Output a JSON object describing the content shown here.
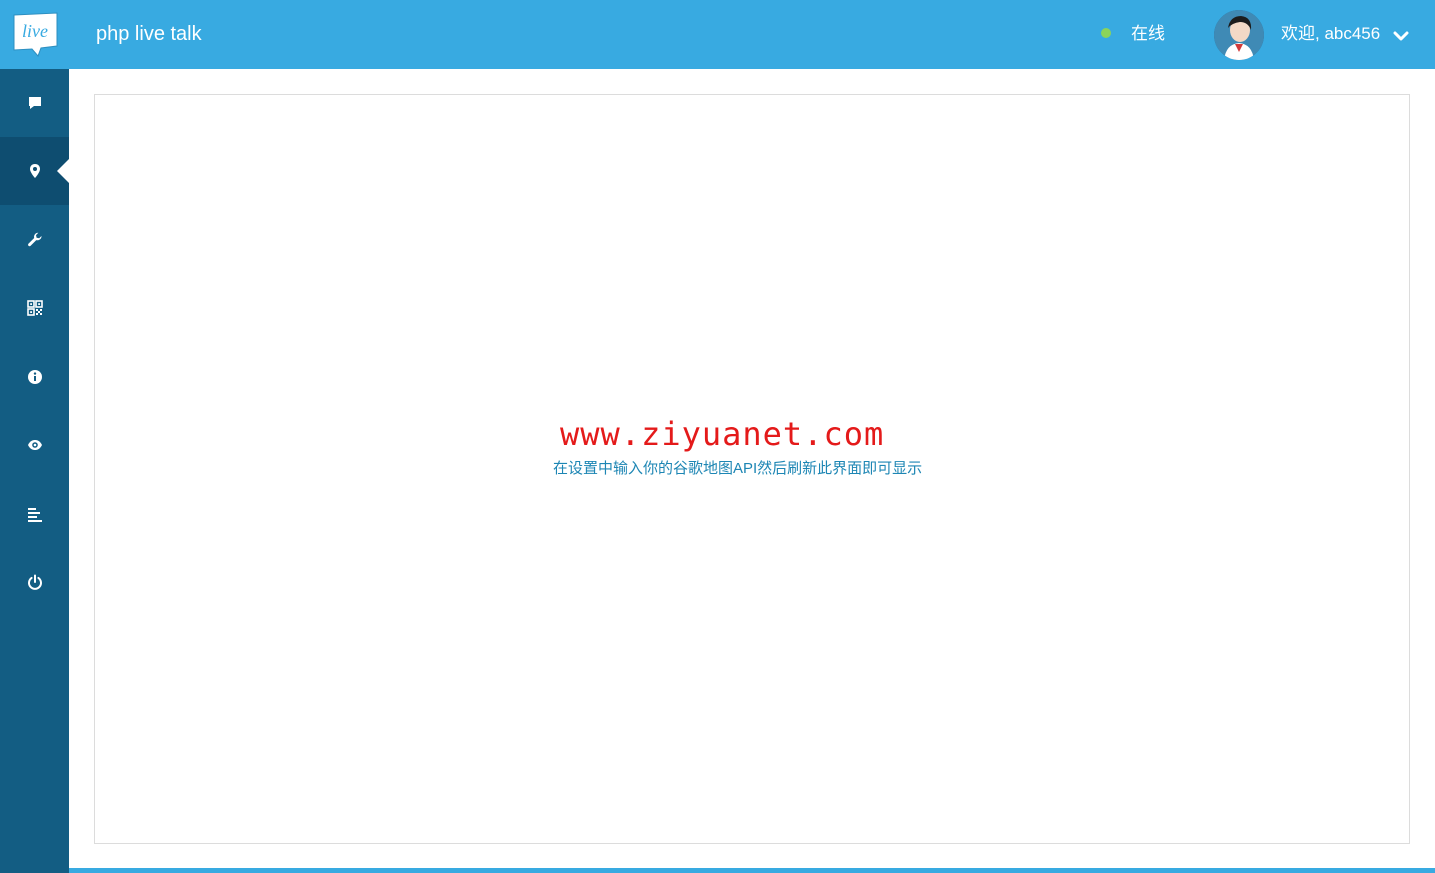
{
  "header": {
    "logo_text": "live",
    "app_title": "php live talk",
    "status_label": "在线",
    "welcome_text": "欢迎, abc456"
  },
  "sidebar": {
    "items": [
      {
        "icon": "chat-icon"
      },
      {
        "icon": "map-marker-icon",
        "active": true
      },
      {
        "icon": "wrench-icon"
      },
      {
        "icon": "qr-code-icon"
      },
      {
        "icon": "info-icon"
      },
      {
        "icon": "eye-icon"
      },
      {
        "icon": "list-icon"
      },
      {
        "icon": "power-icon"
      }
    ]
  },
  "main": {
    "watermark": "www.ziyuanet.com",
    "hint": "在设置中输入你的谷歌地图API然后刷新此界面即可显示"
  },
  "colors": {
    "topbar": "#38aae1",
    "sidebar": "#135d83",
    "sidebar_active": "#0e4d70",
    "status_online": "#8bd45a",
    "watermark": "#e41a1a",
    "hint": "#1d86b4"
  }
}
